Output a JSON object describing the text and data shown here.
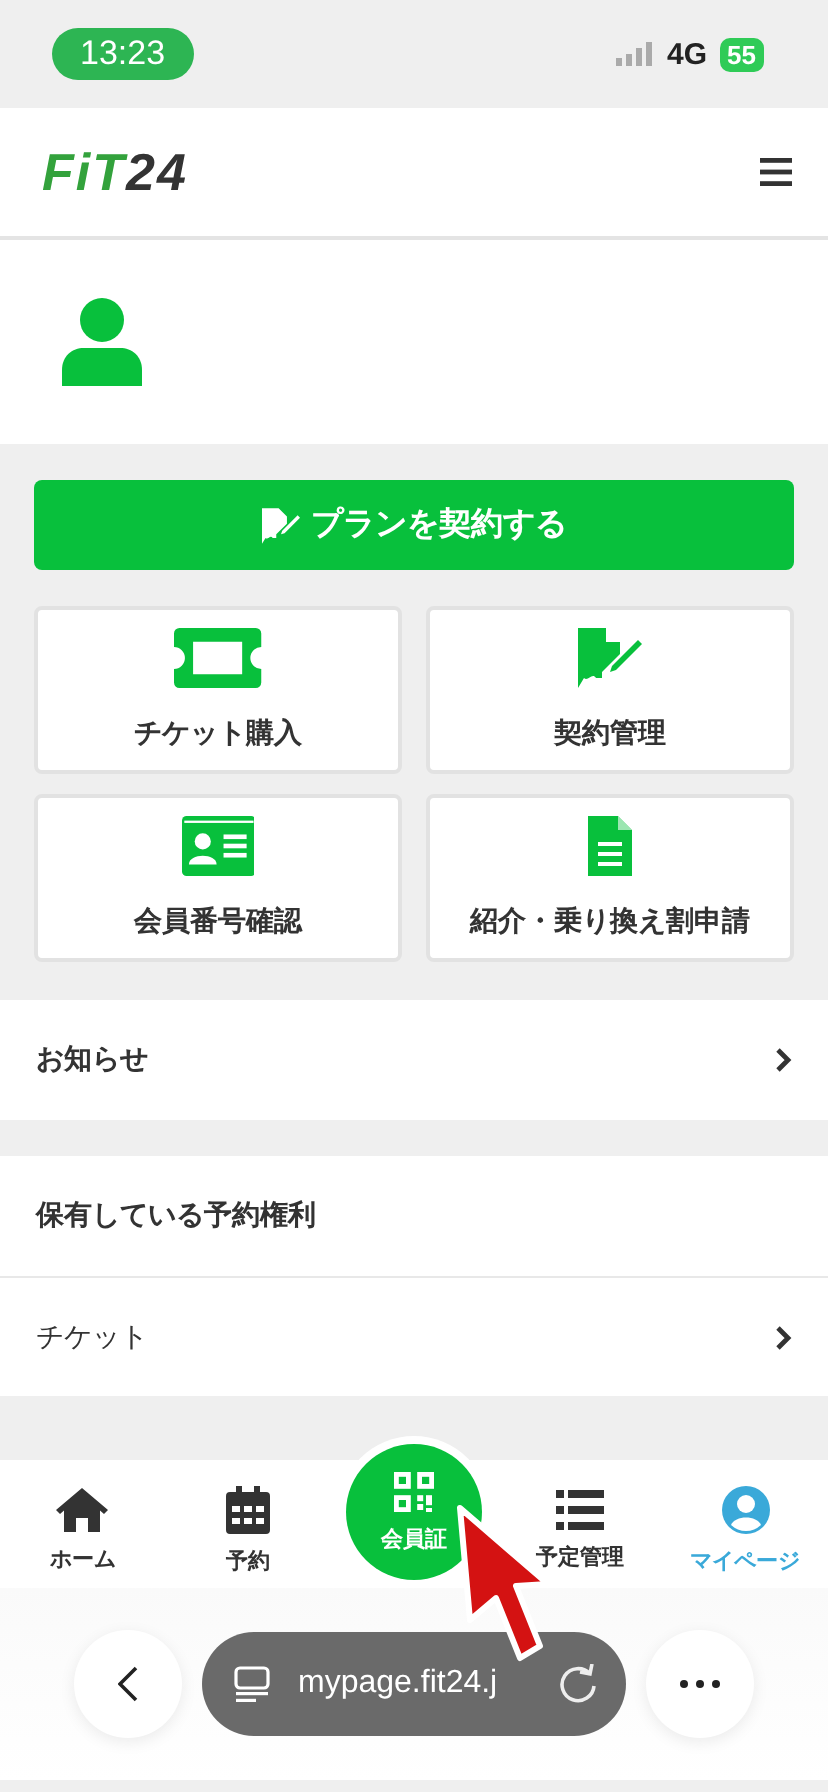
{
  "status_bar": {
    "time": "13:23",
    "network": "4G",
    "battery": "55"
  },
  "header": {
    "logo_parts": [
      "FiT",
      "24"
    ]
  },
  "contract_button": {
    "label": "プランを契約する"
  },
  "tiles": [
    {
      "kind": "ticket",
      "label": "チケット購入"
    },
    {
      "kind": "contract",
      "label": "契約管理"
    },
    {
      "kind": "idcard",
      "label": "会員番号確認"
    },
    {
      "kind": "document",
      "label": "紹介・乗り換え割申請"
    }
  ],
  "sections": [
    {
      "rows": [
        {
          "label": "お知らせ",
          "kind": "link"
        }
      ]
    },
    {
      "rows": [
        {
          "label": "保有している予約権利",
          "kind": "heading"
        },
        {
          "label": "チケット",
          "kind": "link"
        }
      ]
    }
  ],
  "tab_bar": [
    {
      "kind": "home",
      "label": "ホーム",
      "selected": false
    },
    {
      "kind": "calendar",
      "label": "予約",
      "selected": false
    },
    {
      "kind": "center",
      "label": "会員証",
      "selected": false
    },
    {
      "kind": "list",
      "label": "予定管理",
      "selected": false
    },
    {
      "kind": "user",
      "label": "マイページ",
      "selected": true
    }
  ],
  "browser_bar": {
    "url": "mypage.fit24.j"
  }
}
